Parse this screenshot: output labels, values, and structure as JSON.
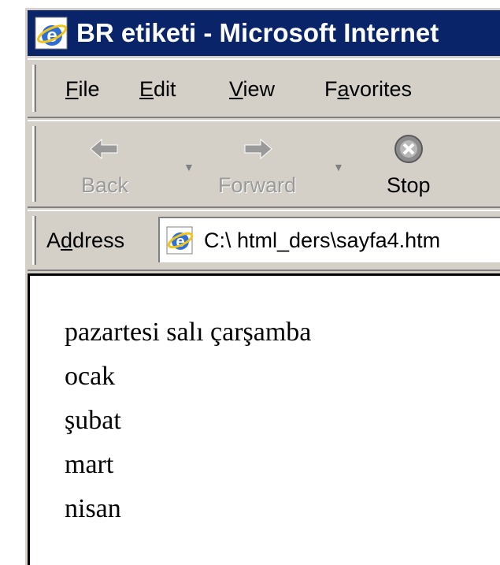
{
  "window": {
    "title": "BR etiketi - Microsoft Internet"
  },
  "menu": {
    "file": {
      "u": "F",
      "rest": "ile"
    },
    "edit": {
      "u": "E",
      "rest": "dit"
    },
    "view": {
      "u": "V",
      "rest": "iew"
    },
    "favorites": {
      "pre": "F",
      "u": "a",
      "rest": "vorites"
    }
  },
  "toolbar": {
    "back_label": "Back",
    "forward_label": "Forward",
    "stop_label": "Stop"
  },
  "address": {
    "label_pre": "A",
    "label_u": "d",
    "label_rest": "dress",
    "value": "C:\\ html_ders\\sayfa4.htm"
  },
  "content": {
    "lines": [
      "pazartesi salı çarşamba",
      "ocak",
      "şubat",
      "mart",
      "nisan"
    ]
  },
  "colors": {
    "titlebar": "#0a246a",
    "chrome": "#d4d0c8",
    "page": "#ffffff"
  },
  "icons": {
    "title": "ie-icon",
    "address": "ie-page-icon",
    "back": "back-arrow-icon",
    "forward": "forward-arrow-icon",
    "stop": "stop-icon"
  }
}
